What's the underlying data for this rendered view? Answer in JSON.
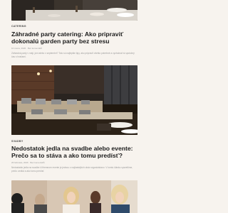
{
  "articles": [
    {
      "category": "",
      "title": "",
      "meta": "",
      "excerpt": "",
      "image_icon": "restaurant-table-photo"
    },
    {
      "category": "CATERING",
      "title": "Záhradné party catering: Ako pripraviť dokonalú garden party bez stresu",
      "meta": "10 února, 2026 · Bez komentářů",
      "excerpt": "Záhradná party v máji, júni alebo v septembri? Toto sú najlepšie tipy, ako pripraviť všetko potrebné a vychutnať si spoločný čas s hosťami.",
      "image_icon": "banquet-hall-photo"
    },
    {
      "category": "SVADBY",
      "title": "Nedostatok jedla na svadbe alebo evente: Prečo sa to stáva a ako tomu predísť?",
      "meta": "26 februára, 2026 · Bez komentářů",
      "excerpt": "Nedostatok jedla na svadbe či firemnom evente je jednou z najčastejších obáv organizátorov. V tomto článku vysvetlíme, prečo vzniká a ako tomu predísť.",
      "image_icon": "wedding-guests-photo"
    }
  ]
}
